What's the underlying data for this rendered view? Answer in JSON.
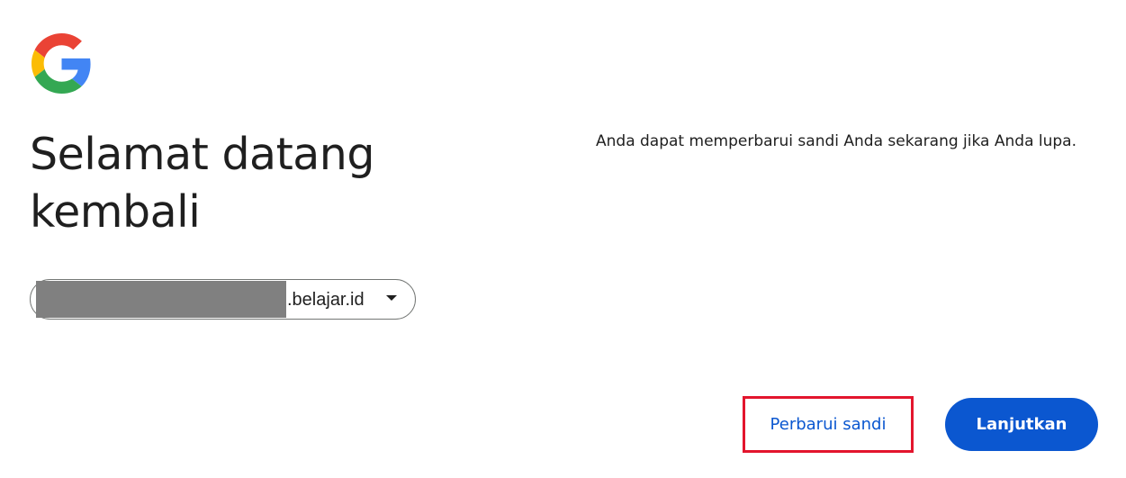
{
  "logo": {
    "icon": "google-g-logo-icon"
  },
  "heading": {
    "title": "Selamat datang kembali"
  },
  "account": {
    "domain_suffix": ".belajar.id",
    "redaction_color": "#808080",
    "caret_icon": "caret-down-icon"
  },
  "info": {
    "text": "Anda dapat memperbarui sandi Anda sekarang jika Anda lupa."
  },
  "actions": {
    "update_password_label": "Perbarui sandi",
    "continue_label": "Lanjutkan"
  },
  "colors": {
    "primary": "#0b57d0",
    "highlight": "#e3152d",
    "text": "#1f1f1f",
    "border": "#747775"
  }
}
